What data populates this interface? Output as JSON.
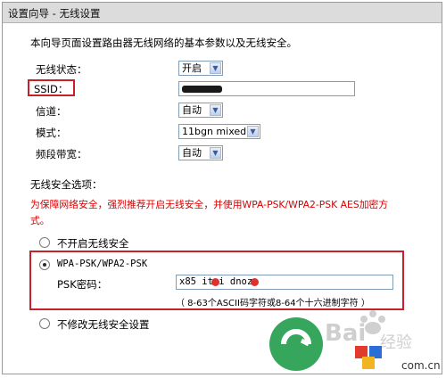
{
  "header": {
    "title": "设置向导 - 无线设置"
  },
  "description": "本向导页面设置路由器无线网络的基本参数以及无线安全。",
  "fields": {
    "wireless_status": {
      "label": "无线状态：",
      "value": "开启"
    },
    "ssid": {
      "label": "SSID：",
      "value": ""
    },
    "channel": {
      "label": "信道：",
      "value": "自动"
    },
    "mode": {
      "label": "模式：",
      "value": "11bgn mixed"
    },
    "bandwidth": {
      "label": "频段带宽：",
      "value": "自动"
    }
  },
  "security": {
    "section_label": "无线安全选项：",
    "warning_line1": "为保障网络安全，强烈推荐开启无线安全，并使用WPA-PSK/WPA2-PSK AES加密方",
    "warning_line2": "式。",
    "options": {
      "none": "不开启无线安全",
      "wpa": "WPA-PSK/WPA2-PSK",
      "keep": "不修改无线安全设置"
    },
    "selected": "wpa",
    "psk_label": "PSK密码：",
    "psk_value": "x85 itoi dnoz",
    "psk_hint": "（ 8-63个ASCII码字符或8-64个十六进制字符 ）"
  },
  "watermark": {
    "text": "Bai",
    "suffix": "经验",
    "site": "com.cn"
  },
  "colors": {
    "warning": "#d40000",
    "highlight_box": "#c8202a",
    "header_bg": "#dcdcdc"
  }
}
